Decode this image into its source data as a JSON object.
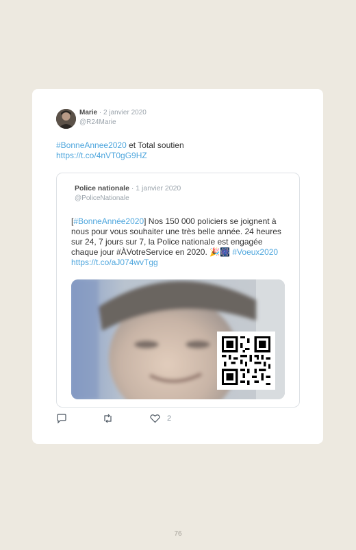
{
  "tweet": {
    "author_name": "Marie",
    "date": " · 2 janvier 2020",
    "handle": "@R24Marie",
    "hashtag": "#BonneAnnee2020",
    "text": " et Total soutien",
    "link": "https://t.co/4nVT0gG9HZ",
    "like_count": "2"
  },
  "quoted": {
    "author_name": "Police nationale",
    "date": " · 1 janvier 2020",
    "handle": "@PoliceNationale",
    "bracket_open": "[",
    "hashtag": "#BonneAnnée2020",
    "text_main": "] Nos 150 000 policiers se joignent à nous pour vous souhaiter une très belle année. 24 heures sur 24, 7 jours sur 7, la Police nationale est engagée chaque jour #ÀVotreService en 2020. ",
    "emojis": "🎉🎆",
    "hashtag2": "#Voeux2020",
    "link": "https://t.co/aJ074wvTgg"
  },
  "icons": {
    "reply": "reply-icon",
    "retweet": "retweet-icon",
    "like": "heart-icon"
  },
  "colors": {
    "link": "#4ea6dd",
    "background": "#ede9e0"
  },
  "page_number": "76"
}
